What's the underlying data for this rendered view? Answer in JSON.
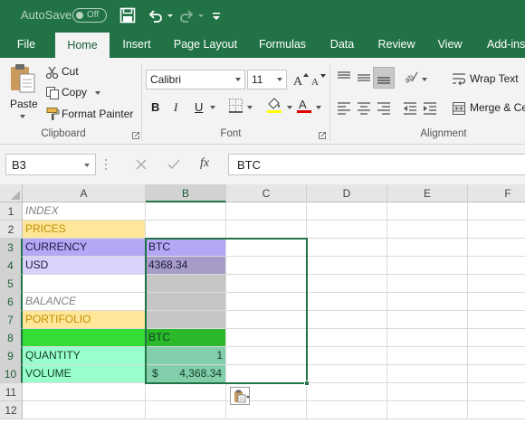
{
  "titlebar": {
    "autosave_label": "AutoSave",
    "autosave_state": "Off"
  },
  "tabs": [
    "File",
    "Home",
    "Insert",
    "Page Layout",
    "Formulas",
    "Data",
    "Review",
    "View",
    "Add-ins"
  ],
  "active_tab": "Home",
  "ribbon": {
    "clipboard": {
      "paste": "Paste",
      "cut": "Cut",
      "copy": "Copy",
      "format_painter": "Format Painter",
      "label": "Clipboard"
    },
    "font": {
      "font_name": "Calibri",
      "font_size": "11",
      "bold": "B",
      "italic": "I",
      "underline": "U",
      "label": "Font"
    },
    "alignment": {
      "wrap_text": "Wrap Text",
      "merge": "Merge & Ce",
      "label": "Alignment"
    }
  },
  "formula_bar": {
    "name_box": "B3",
    "fx": "fx",
    "formula": "BTC"
  },
  "columns": [
    "A",
    "B",
    "C",
    "D",
    "E",
    "F"
  ],
  "rows": [
    "1",
    "2",
    "3",
    "4",
    "5",
    "6",
    "7",
    "8",
    "9",
    "10",
    "11",
    "12"
  ],
  "cells": {
    "A1": "INDEX",
    "A2": "PRICES",
    "A3": "CURRENCY",
    "B3": "BTC",
    "A4": "USD",
    "B4": "4368.34",
    "A6": "BALANCE",
    "A7": "PORTIFOLIO",
    "B8": "BTC",
    "A9": "QUANTITY",
    "B9": "1",
    "A10": "VOLUME",
    "B10_symbol": "$",
    "B10_value": "4,368.34"
  },
  "colors": {
    "excel_green": "#217346",
    "prices_fill": "#ffe699",
    "currency_fill": "#b4a7f5",
    "usd_fill": "#d9d2fb",
    "green_fill": "#33dd33",
    "light_green_fill": "#99ffcc",
    "underline_red": "#e00000",
    "highlight_yellow": "#ffff00"
  }
}
